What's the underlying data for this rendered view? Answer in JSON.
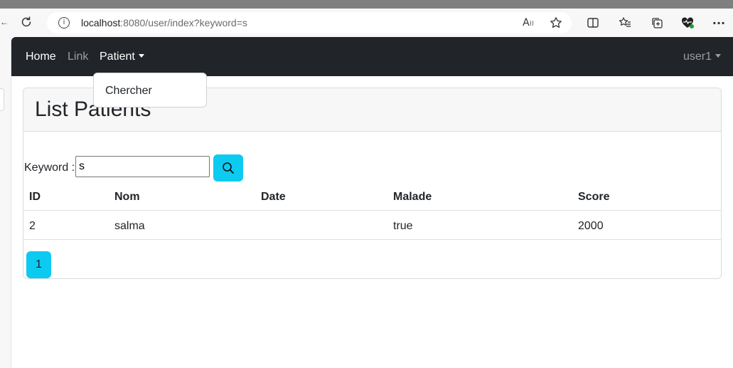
{
  "browser": {
    "url_host": "localhost",
    "url_rest": ":8080/user/index?keyword=s",
    "icons": [
      "refresh-icon",
      "info-icon",
      "read-aloud-icon",
      "favorite-star-icon",
      "split-screen-icon",
      "favorites-icon",
      "collections-icon",
      "health-icon",
      "more-icon"
    ]
  },
  "navbar": {
    "home": "Home",
    "link": "Link",
    "patient": "Patient",
    "user": "user1",
    "dropdown_item": "Chercher"
  },
  "card": {
    "title": "List Patients"
  },
  "search": {
    "label": "Keyword :",
    "value": "s",
    "button_icon": "search-icon"
  },
  "table": {
    "headers": [
      "ID",
      "Nom",
      "Date",
      "Malade",
      "Score"
    ],
    "rows": [
      [
        "2",
        "salma",
        "",
        "true",
        "2000"
      ]
    ]
  },
  "pagination": {
    "pages": [
      "1"
    ]
  },
  "colors": {
    "navbar": "#212529",
    "accent": "#0dcaf0",
    "card_header": "#f7f7f7"
  }
}
